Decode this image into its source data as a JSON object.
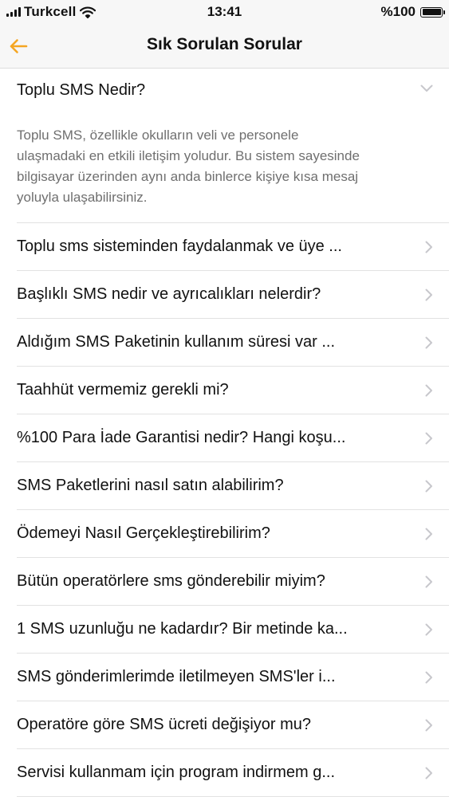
{
  "status_bar": {
    "carrier": "Turkcell",
    "time": "13:41",
    "battery": "%100"
  },
  "nav": {
    "title": "Sık Sorulan Sorular",
    "accent_color": "#f5a623"
  },
  "faq": {
    "open_item": {
      "question": "Toplu SMS Nedir?",
      "answer_lines": [
        "Toplu SMS, özellikle okulların veli ve personele",
        "ulaşmadaki en etkili iletişim yoludur. Bu sistem sayesinde",
        "bilgisayar üzerinden aynı anda binlerce kişiye kısa mesaj",
        "yoluyla ulaşabilirsiniz."
      ]
    },
    "items": [
      "Toplu sms sisteminden faydalanmak ve üye ...",
      "Başlıklı SMS nedir ve ayrıcalıkları nelerdir?",
      "Aldığım SMS Paketinin kullanım süresi var ...",
      "Taahhüt vermemiz gerekli mi?",
      "%100 Para İade Garantisi nedir? Hangi koşu...",
      "SMS Paketlerini nasıl satın alabilirim?",
      "Ödemeyi Nasıl Gerçekleştirebilirim?",
      "Bütün operatörlere sms gönderebilir miyim?",
      "1 SMS uzunluğu ne kadardır? Bir metinde ka...",
      "SMS gönderimlerimde iletilmeyen SMS'ler i...",
      "Operatöre göre SMS ücreti değişiyor mu?",
      "Servisi kullanmam için program indirmem g..."
    ]
  }
}
